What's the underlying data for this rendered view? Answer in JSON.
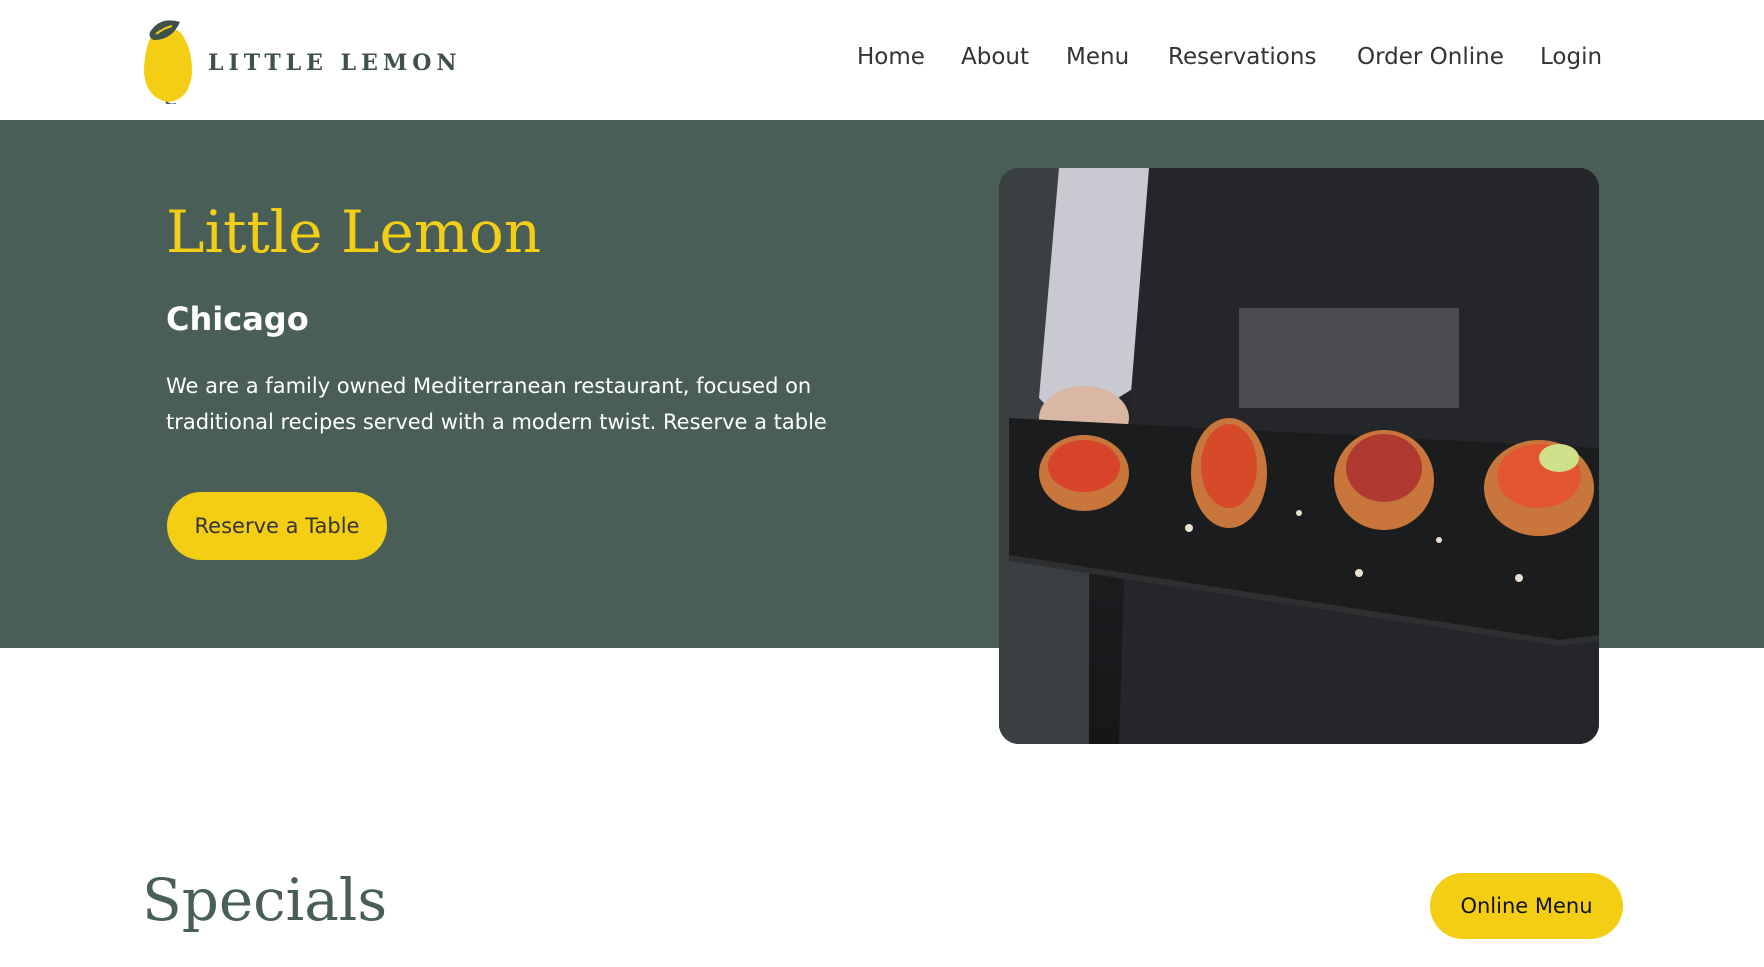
{
  "header": {
    "brand": "LITTLE LEMON",
    "nav": [
      {
        "label": "Home"
      },
      {
        "label": "About"
      },
      {
        "label": "Menu"
      },
      {
        "label": "Reservations"
      },
      {
        "label": "Order Online"
      },
      {
        "label": "Login"
      }
    ]
  },
  "hero": {
    "title": "Little Lemon",
    "subtitle": "Chicago",
    "description": "We are a family owned Mediterranean restaurant, focused on traditional recipes served with a modern twist. Reserve a table",
    "reserve_label": "Reserve a Table",
    "photo_icon": "food-photo"
  },
  "specials": {
    "title": "Specials",
    "online_menu_label": "Online Menu"
  },
  "colors": {
    "primary_green": "#495e57",
    "primary_yellow": "#f4ce14",
    "text_dark": "#333333",
    "white": "#ffffff"
  }
}
